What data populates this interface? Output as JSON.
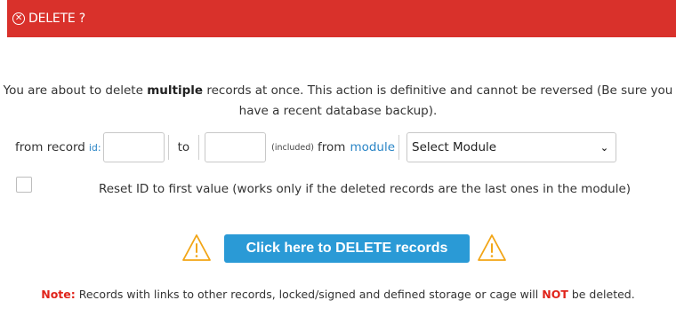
{
  "header": {
    "icon": "circle-x-icon",
    "title": "DELETE ?"
  },
  "intro": {
    "pre": "You are about to delete ",
    "bold": "multiple",
    "post": " records at once. This action is definitive and cannot be reversed (Be sure you have a recent database backup)."
  },
  "range": {
    "from_label": "from record",
    "id_label": "id:",
    "from_value": "",
    "to_label": "to",
    "to_value": "",
    "included_label": "(included)",
    "module_from_label": "from",
    "module_link": "module",
    "module_select": "Select Module"
  },
  "reset": {
    "checked": false,
    "label": "Reset ID to first value (works only if the deleted records are the last ones in the module)"
  },
  "actions": {
    "delete_button": "Click here to DELETE records",
    "warning_icon": "warning-triangle-icon"
  },
  "note": {
    "label": "Note:",
    "pre": " Records with links to other records, locked/signed and defined storage or cage will ",
    "not": "NOT",
    "post": " be deleted."
  },
  "colors": {
    "header": "#d9312b",
    "button": "#2a9ad6",
    "link": "#2a85c6",
    "warning": "#f2a516",
    "note_red": "#e0241b"
  }
}
